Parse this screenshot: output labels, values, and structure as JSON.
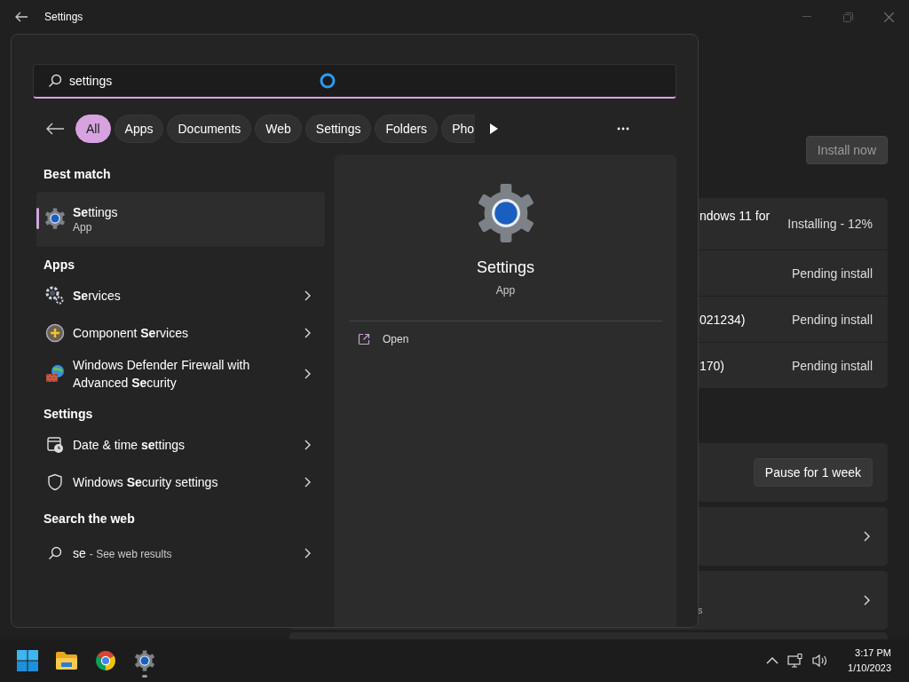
{
  "settings_window": {
    "title": "Settings",
    "install_button": "Install now",
    "updates": [
      {
        "name": "ndows 11 for",
        "status": "Installing - 12%"
      },
      {
        "status": "Pending install"
      },
      {
        "name": "021234)",
        "status": "Pending install"
      },
      {
        "name": "170)",
        "status": "Pending install"
      }
    ],
    "pause_button": "Pause for 1 week",
    "link_cards": [
      {
        "kind": "link"
      },
      {
        "kind": "link",
        "description": "s"
      }
    ]
  },
  "search_panel": {
    "search": {
      "value": "settings"
    },
    "filters": [
      {
        "label": "All",
        "selected": true
      },
      {
        "label": "Apps",
        "selected": false
      },
      {
        "label": "Documents",
        "selected": false
      },
      {
        "label": "Web",
        "selected": false
      },
      {
        "label": "Settings",
        "selected": false
      },
      {
        "label": "Folders",
        "selected": false
      },
      {
        "label": "Pho",
        "selected": false
      }
    ],
    "best_match": {
      "heading": "Best match",
      "title": "**Se**ttings",
      "subtitle": "App",
      "selected": true
    },
    "sections": [
      {
        "heading": "Apps",
        "items": [
          {
            "title": "**Se**rvices",
            "selected": false
          },
          {
            "title": "Component **Se**rvices",
            "selected": false
          },
          {
            "title": "Windows Defender Firewall with Advanced **Se**curity",
            "selected": false
          }
        ]
      },
      {
        "heading": "Settings",
        "items": [
          {
            "title": "Date & time **se**ttings",
            "selected": false
          },
          {
            "title": "Windows **Se**curity settings",
            "selected": false
          }
        ]
      }
    ],
    "web": {
      "heading": "Search the web",
      "query": "se",
      "suffix": "- See web results"
    },
    "preview": {
      "title": "Settings",
      "subtitle": "App",
      "actions": [
        "Open"
      ]
    }
  },
  "taskbar": {
    "apps": [
      {
        "running": false
      },
      {
        "running": false
      },
      {
        "running": false
      },
      {
        "running": true
      }
    ],
    "time": "3:17 PM",
    "date": "1/10/2023"
  }
}
